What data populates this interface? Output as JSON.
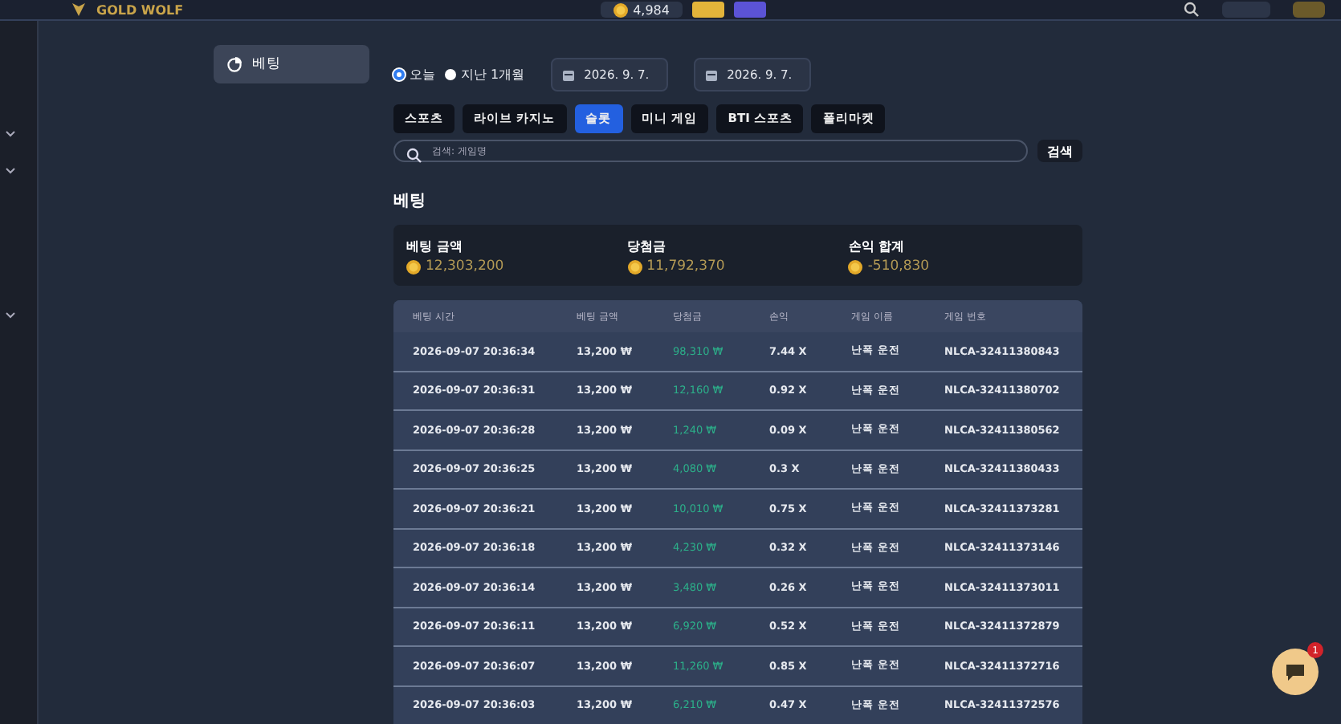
{
  "header": {
    "logo": "GOLD WOLF",
    "balance": "4,984"
  },
  "side_menu": [
    {
      "label": "베팅",
      "selected": true
    }
  ],
  "period": [
    {
      "label": "오늘",
      "selected": true
    },
    {
      "label": "지난 1개월",
      "selected": false
    }
  ],
  "dates": [
    "2026. 9. 7.",
    "2026. 9. 7."
  ],
  "tabs": [
    {
      "label": "스포츠",
      "selected": false
    },
    {
      "label": "라이브 카지노",
      "selected": false
    },
    {
      "label": "슬롯",
      "selected": true
    },
    {
      "label": "미니 게임",
      "selected": false
    },
    {
      "label": "BTI 스포츠",
      "selected": false
    },
    {
      "label": "폴리마켓",
      "selected": false
    }
  ],
  "search": {
    "placeholder": "검색: 게임명",
    "button": "검색"
  },
  "title": "베팅",
  "summary": [
    {
      "label": "베팅 금액",
      "value": "12,303,200"
    },
    {
      "label": "당첨금",
      "value": "11,792,370"
    },
    {
      "label": "손익 합계",
      "value": "-510,830"
    }
  ],
  "table": {
    "columns": [
      "베팅 시간",
      "베팅 금액",
      "당첨금",
      "손익",
      "게임 이름",
      "게임 번호"
    ],
    "rows": [
      [
        "2026-09-07 20:36:34",
        "13,200 ₩",
        "98,310 ₩",
        "7.44 X",
        "난폭 운전",
        "NLCA-32411380843"
      ],
      [
        "2026-09-07 20:36:31",
        "13,200 ₩",
        "12,160 ₩",
        "0.92 X",
        "난폭 운전",
        "NLCA-32411380702"
      ],
      [
        "2026-09-07 20:36:28",
        "13,200 ₩",
        "1,240 ₩",
        "0.09 X",
        "난폭 운전",
        "NLCA-32411380562"
      ],
      [
        "2026-09-07 20:36:25",
        "13,200 ₩",
        "4,080 ₩",
        "0.3 X",
        "난폭 운전",
        "NLCA-32411380433"
      ],
      [
        "2026-09-07 20:36:21",
        "13,200 ₩",
        "10,010 ₩",
        "0.75 X",
        "난폭 운전",
        "NLCA-32411373281"
      ],
      [
        "2026-09-07 20:36:18",
        "13,200 ₩",
        "4,230 ₩",
        "0.32 X",
        "난폭 운전",
        "NLCA-32411373146"
      ],
      [
        "2026-09-07 20:36:14",
        "13,200 ₩",
        "3,480 ₩",
        "0.26 X",
        "난폭 운전",
        "NLCA-32411373011"
      ],
      [
        "2026-09-07 20:36:11",
        "13,200 ₩",
        "6,920 ₩",
        "0.52 X",
        "난폭 운전",
        "NLCA-32411372879"
      ],
      [
        "2026-09-07 20:36:07",
        "13,200 ₩",
        "11,260 ₩",
        "0.85 X",
        "난폭 운전",
        "NLCA-32411372716"
      ],
      [
        "2026-09-07 20:36:03",
        "13,200 ₩",
        "6,210 ₩",
        "0.47 X",
        "난폭 운전",
        "NLCA-32411372576"
      ]
    ]
  },
  "chat": {
    "badge": "1"
  }
}
